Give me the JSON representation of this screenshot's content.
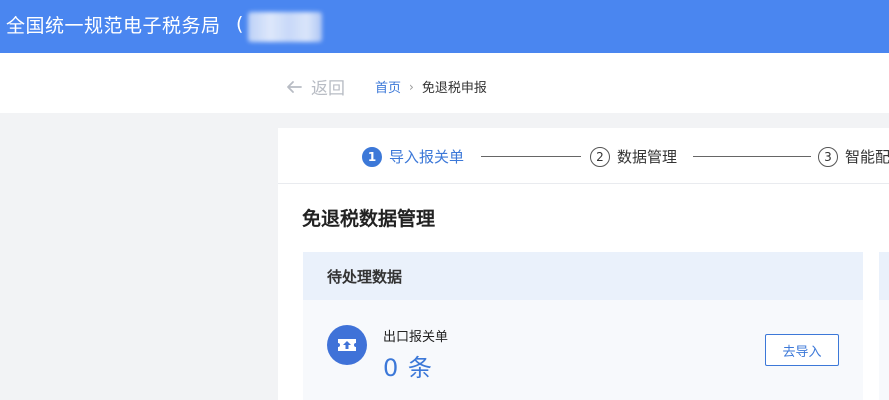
{
  "header": {
    "title": "全国统一规范电子税务局",
    "user_paren": "("
  },
  "nav": {
    "back_label": "返回",
    "breadcrumb": {
      "home": "首页",
      "separator": "›",
      "current": "免退税申报"
    }
  },
  "steps": [
    {
      "num": "1",
      "label": "导入报关单",
      "active": true
    },
    {
      "num": "2",
      "label": "数据管理",
      "active": false
    },
    {
      "num": "3",
      "label": "智能配",
      "active": false
    }
  ],
  "main": {
    "section_title": "免退税数据管理",
    "pending": {
      "header": "待处理数据",
      "item_label": "出口报关单",
      "item_count": "0 条",
      "button_label": "去导入"
    }
  },
  "colors": {
    "accent": "#3c78d8",
    "topbar": "#4a86f0"
  }
}
